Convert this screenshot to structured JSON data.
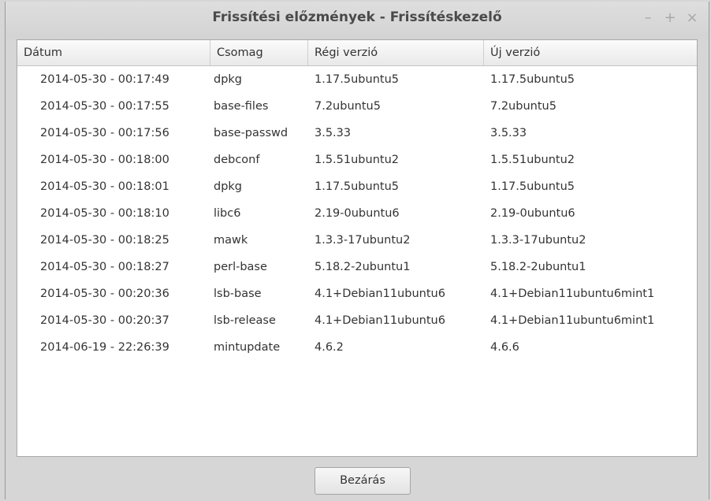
{
  "window": {
    "title": "Frissítési előzmények - Frissítéskezelő",
    "controls": {
      "minimize": "–",
      "maximize": "+",
      "close": "×"
    }
  },
  "table": {
    "columns": [
      "Dátum",
      "Csomag",
      "Régi verzió",
      "Új verzió"
    ],
    "rows": [
      [
        "2014-05-30 - 00:17:49",
        "dpkg",
        "1.17.5ubuntu5",
        "1.17.5ubuntu5"
      ],
      [
        "2014-05-30 - 00:17:55",
        "base-files",
        "7.2ubuntu5",
        "7.2ubuntu5"
      ],
      [
        "2014-05-30 - 00:17:56",
        "base-passwd",
        "3.5.33",
        "3.5.33"
      ],
      [
        "2014-05-30 - 00:18:00",
        "debconf",
        "1.5.51ubuntu2",
        "1.5.51ubuntu2"
      ],
      [
        "2014-05-30 - 00:18:01",
        "dpkg",
        "1.17.5ubuntu5",
        "1.17.5ubuntu5"
      ],
      [
        "2014-05-30 - 00:18:10",
        "libc6",
        "2.19-0ubuntu6",
        "2.19-0ubuntu6"
      ],
      [
        "2014-05-30 - 00:18:25",
        "mawk",
        "1.3.3-17ubuntu2",
        "1.3.3-17ubuntu2"
      ],
      [
        "2014-05-30 - 00:18:27",
        "perl-base",
        "5.18.2-2ubuntu1",
        "5.18.2-2ubuntu1"
      ],
      [
        "2014-05-30 - 00:20:36",
        "lsb-base",
        "4.1+Debian11ubuntu6",
        "4.1+Debian11ubuntu6mint1"
      ],
      [
        "2014-05-30 - 00:20:37",
        "lsb-release",
        "4.1+Debian11ubuntu6",
        "4.1+Debian11ubuntu6mint1"
      ],
      [
        "2014-06-19 - 22:26:39",
        "mintupdate",
        "4.6.2",
        "4.6.6"
      ]
    ]
  },
  "footer": {
    "close_label": "Bezárás"
  }
}
